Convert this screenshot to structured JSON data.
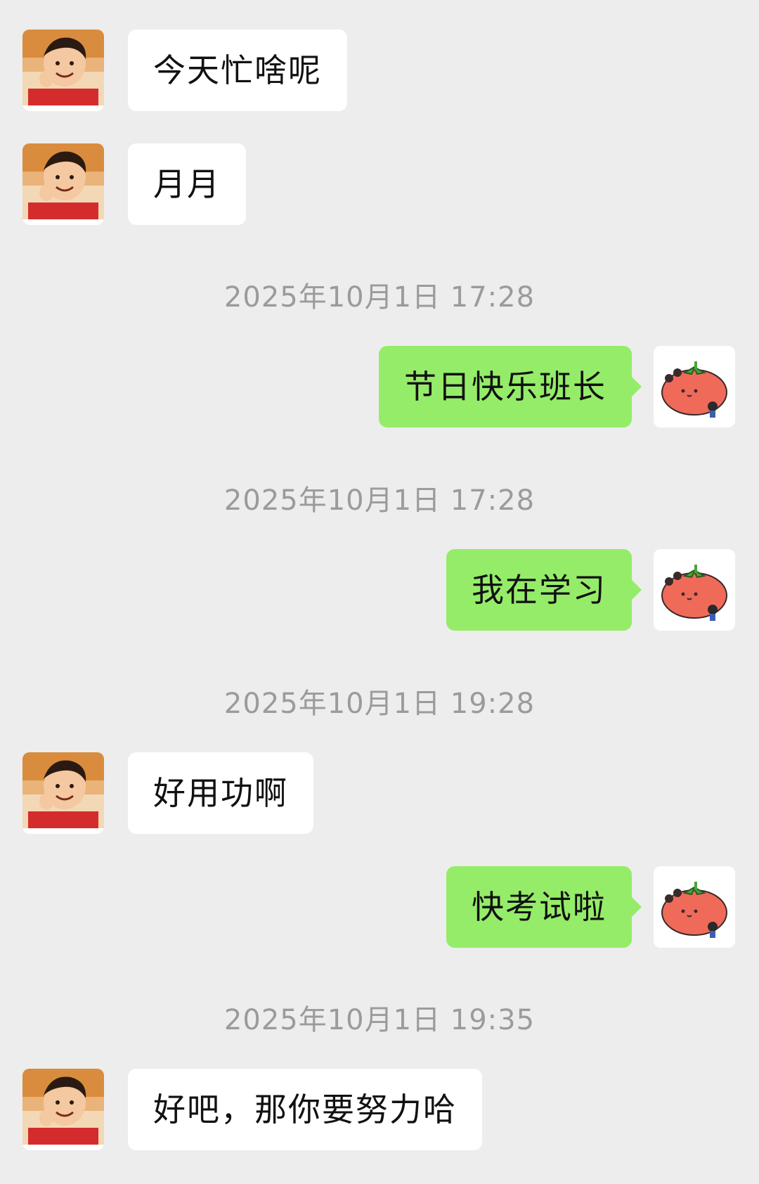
{
  "conversation": {
    "messages": [
      {
        "side": "in",
        "text": "今天忙啥呢"
      },
      {
        "side": "in",
        "text": "月月"
      },
      {
        "type": "time",
        "text": "2025年10月1日 17:28"
      },
      {
        "side": "out",
        "text": "节日快乐班长"
      },
      {
        "type": "time",
        "text": "2025年10月1日 17:28"
      },
      {
        "side": "out",
        "text": "我在学习"
      },
      {
        "type": "time",
        "text": "2025年10月1日 19:28"
      },
      {
        "side": "in",
        "text": "好用功啊"
      },
      {
        "side": "out",
        "text": "快考试啦"
      },
      {
        "type": "time",
        "text": "2025年10月1日 19:35"
      },
      {
        "side": "in",
        "text": "好吧，那你要努力哈"
      }
    ]
  },
  "avatars": {
    "contact_icon": "child-photo-avatar",
    "self_icon": "tomato-sticker-avatar"
  },
  "colors": {
    "background": "#ededed",
    "incoming_bubble": "#ffffff",
    "outgoing_bubble": "#95ec69",
    "timestamp_text": "#9b9b9b"
  }
}
